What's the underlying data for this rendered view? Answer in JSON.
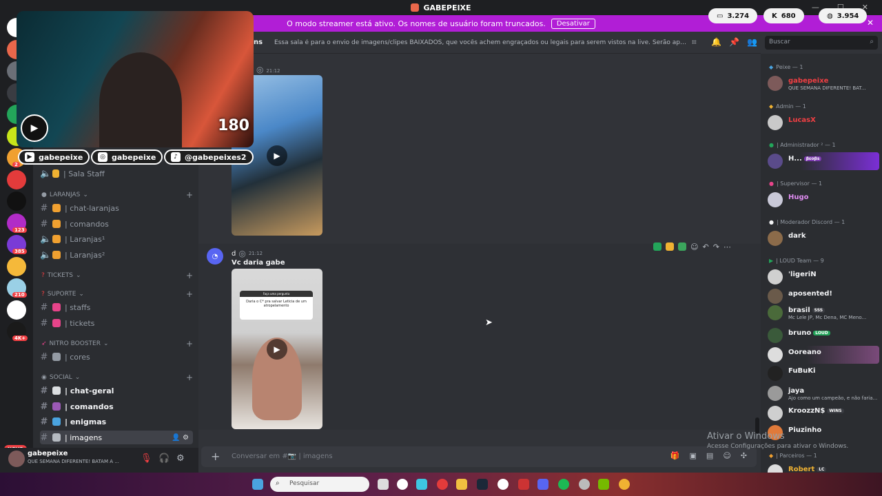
{
  "title_bar": {
    "title": "GABEPEIXE"
  },
  "banner": {
    "text": "O modo streamer está ativo. Os nomes de usuário foram truncados.",
    "button": "Desativar"
  },
  "counters": [
    {
      "icon": "chat-icon",
      "value": "3.274"
    },
    {
      "icon": "kick-icon",
      "value": "680"
    },
    {
      "icon": "globe-icon",
      "value": "3.954"
    }
  ],
  "servers": [
    {
      "color": "#ffffff",
      "badge": ""
    },
    {
      "color": "#e9674b",
      "badge": ""
    },
    {
      "color": "#6b6f77",
      "badge": ""
    },
    {
      "color": "#3a3c42",
      "badge": ""
    },
    {
      "color": "#23a55a",
      "badge": ""
    },
    {
      "color": "#c7e51a",
      "badge": ""
    },
    {
      "color": "#f0a030",
      "badge": "2"
    },
    {
      "color": "#e33b3b",
      "badge": ""
    },
    {
      "color": "#111111",
      "badge": ""
    },
    {
      "color": "#b12cc7",
      "badge": "123"
    },
    {
      "color": "#7a3bd6",
      "badge": "385"
    },
    {
      "color": "#f5b93a",
      "badge": ""
    },
    {
      "color": "#9ad0e6",
      "badge": "210"
    },
    {
      "color": "#ffffff",
      "badge": ""
    },
    {
      "color": "#1a1a1a",
      "badge": "4K+"
    }
  ],
  "rail": {
    "novo": "NOVO"
  },
  "sidebar": {
    "sala_staff": "| Sala Staff",
    "categories": {
      "laranjas": "LARANJAS",
      "tickets": "TICKETS",
      "suporte": "SUPORTE",
      "nitro": "NITRO BOOSTER",
      "social": "SOCIAL"
    },
    "channels": {
      "chat_laranjas": "| chat-laranjas",
      "comandos1": "| comandos",
      "laranjas1": "| Laranjas¹",
      "laranjas2": "| Laranjas²",
      "staffs": "| staffs",
      "tickets": "| tickets",
      "cores": "| cores",
      "chat_geral": "| chat-geral",
      "comandos2": "| comandos",
      "enigmas": "| enigmas",
      "imagens": "| imagens"
    }
  },
  "user_panel": {
    "name": "gabepeixe",
    "status": "QUE SEMANA DIFERENTE! BATAM A ..."
  },
  "channel_header": {
    "name": "ns",
    "topic": "Essa sala é para o envio de imagens/clipes BAIXADOS, que vocês achem engraçados ou legais para serem vistos na live. Serão apagados prints de o..."
  },
  "messages": [
    {
      "author": "",
      "time": "21:12",
      "text": ""
    },
    {
      "author": "d",
      "time": "21:12",
      "text": "Vc daria gabe",
      "card_title": "Faça uma pergunta",
      "card_question": "Daria o C* pra salvar Leticia de um atropelamento"
    }
  ],
  "composer": {
    "placeholder": "Conversar em #📷 | imagens"
  },
  "search": {
    "placeholder": "Buscar"
  },
  "members": {
    "roles": [
      {
        "label": "Peixe — 1"
      },
      {
        "label": "Admin — 1"
      },
      {
        "label": "| Administrador ² — 1"
      },
      {
        "label": "| Supervisor — 1"
      },
      {
        "label": "| Moderador Discord — 1"
      },
      {
        "label": "| LOUD Team — 9"
      },
      {
        "label": "| Parceiros — 1"
      }
    ],
    "list": [
      {
        "name": "gabepeixe",
        "sub": "QUE SEMANA DIFERENTE! BAT...",
        "color": "#f23f43",
        "tag": ""
      },
      {
        "name": "LucasX",
        "sub": "",
        "color": "#f23f43",
        "tag": ""
      },
      {
        "name": "H...",
        "sub": "",
        "color": "#ffffff",
        "tag": "βεοβs"
      },
      {
        "name": "Hugo",
        "sub": "",
        "color": "#e08df2",
        "tag": ""
      },
      {
        "name": "dark",
        "sub": "",
        "color": "#f2f3f5",
        "tag": ""
      },
      {
        "name": "'ligeriN",
        "sub": "",
        "color": "#f2f3f5",
        "tag": ""
      },
      {
        "name": "aposented!",
        "sub": "",
        "color": "#f2f3f5",
        "tag": ""
      },
      {
        "name": "brasil",
        "sub": "Mc Lele JP, Mc Dena, MC Meno...",
        "color": "#f2f3f5",
        "tag": "SSS"
      },
      {
        "name": "bruno",
        "sub": "",
        "color": "#f2f3f5",
        "tag": "LOUD"
      },
      {
        "name": "Ooreano",
        "sub": "",
        "color": "#f2f3f5",
        "tag": ""
      },
      {
        "name": "FuBuKi",
        "sub": "",
        "color": "#f2f3f5",
        "tag": ""
      },
      {
        "name": "jaya",
        "sub": "Ajo como um campeão, e não faria...",
        "color": "#f2f3f5",
        "tag": ""
      },
      {
        "name": "KroozzN$",
        "sub": "",
        "color": "#f2f3f5",
        "tag": "WINS"
      },
      {
        "name": "Piuzinho",
        "sub": "",
        "color": "#f2f3f5",
        "tag": ""
      },
      {
        "name": "Robert",
        "sub": "",
        "color": "#f0b232",
        "tag": "LC"
      }
    ]
  },
  "stream_overlay": {
    "number": "180",
    "socials": [
      {
        "icon": "youtube-icon",
        "handle": "gabepeixe"
      },
      {
        "icon": "instagram-icon",
        "handle": "gabepeixe"
      },
      {
        "icon": "tiktok-icon",
        "handle": "@gabepeixes2"
      }
    ]
  },
  "watermark": {
    "title": "Ativar o Windows",
    "sub": "Acesse Configurações para ativar o Windows."
  },
  "taskbar": {
    "search_placeholder": "Pesquisar"
  }
}
